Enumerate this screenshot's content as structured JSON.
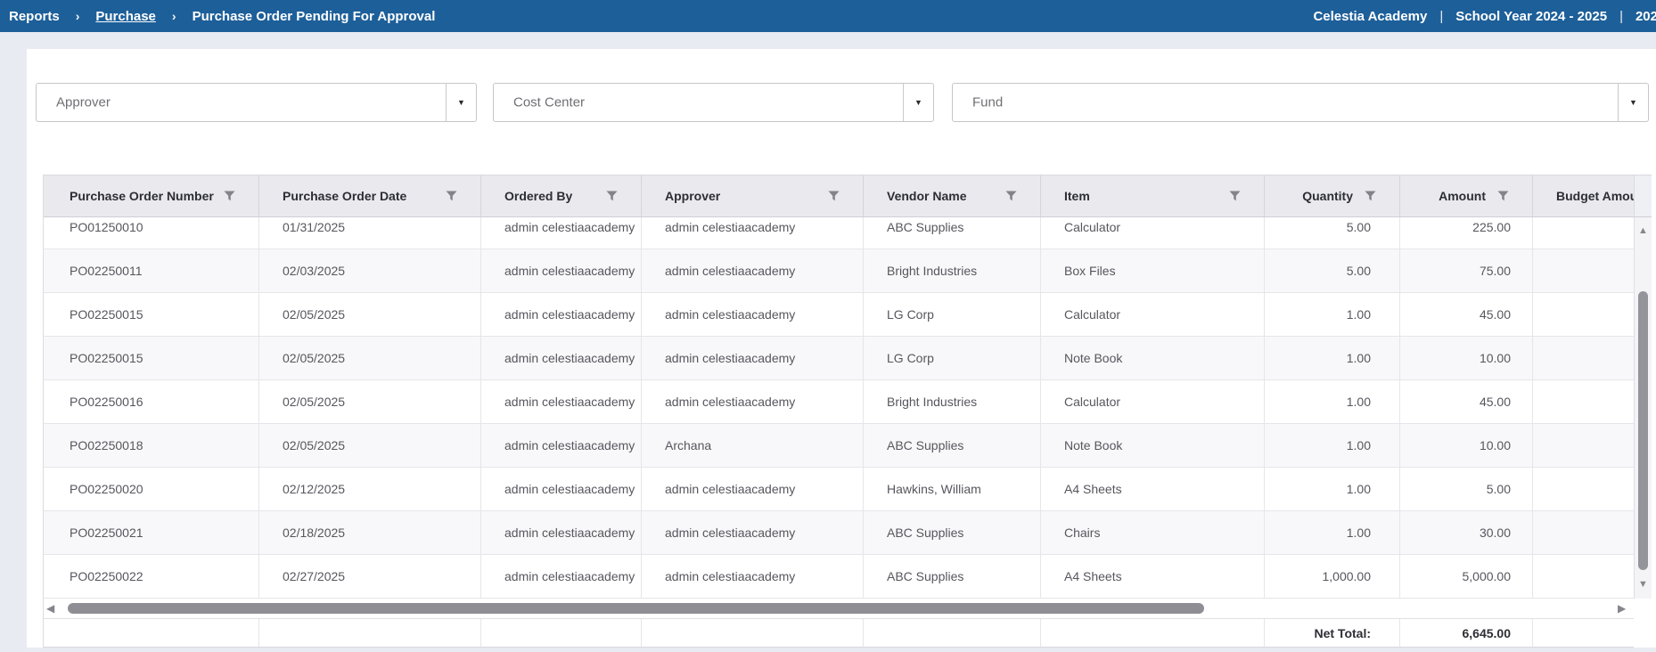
{
  "colors": {
    "topbar_bg": "#1d5f99",
    "page_bg": "#e9ebf2",
    "table_header_bg": "#e9e9ee"
  },
  "topbar": {
    "breadcrumb": [
      {
        "label": "Reports",
        "link": false
      },
      {
        "label": "Purchase",
        "link": true
      },
      {
        "label": "Purchase Order Pending For Approval",
        "link": false
      }
    ],
    "separator": "›",
    "pipe": "|",
    "info_segments": [
      "Celestia Academy",
      "School Year 2024 - 2025",
      "202"
    ]
  },
  "filters": [
    {
      "placeholder": "Approver"
    },
    {
      "placeholder": "Cost Center"
    },
    {
      "placeholder": "Fund"
    }
  ],
  "table": {
    "columns": [
      {
        "label": "Purchase Order Number",
        "filter": true,
        "align": "left"
      },
      {
        "label": "Purchase Order Date",
        "filter": true,
        "align": "left"
      },
      {
        "label": "Ordered By",
        "filter": true,
        "align": "left"
      },
      {
        "label": "Approver",
        "filter": true,
        "align": "left"
      },
      {
        "label": "Vendor Name",
        "filter": true,
        "align": "left"
      },
      {
        "label": "Item",
        "filter": true,
        "align": "left"
      },
      {
        "label": "Quantity",
        "filter": true,
        "align": "right"
      },
      {
        "label": "Amount",
        "filter": true,
        "align": "right"
      },
      {
        "label": "Budget Amount",
        "filter": false,
        "align": "left"
      }
    ],
    "rows": [
      [
        "PO01250010",
        "01/31/2025",
        "admin celestiaacademy",
        "admin celestiaacademy",
        "ABC Supplies",
        "Calculator",
        "5.00",
        "225.00",
        ""
      ],
      [
        "PO02250011",
        "02/03/2025",
        "admin celestiaacademy",
        "admin celestiaacademy",
        "Bright Industries",
        "Box Files",
        "5.00",
        "75.00",
        ""
      ],
      [
        "PO02250015",
        "02/05/2025",
        "admin celestiaacademy",
        "admin celestiaacademy",
        "LG Corp",
        "Calculator",
        "1.00",
        "45.00",
        ""
      ],
      [
        "PO02250015",
        "02/05/2025",
        "admin celestiaacademy",
        "admin celestiaacademy",
        "LG Corp",
        "Note Book",
        "1.00",
        "10.00",
        ""
      ],
      [
        "PO02250016",
        "02/05/2025",
        "admin celestiaacademy",
        "admin celestiaacademy",
        "Bright Industries",
        "Calculator",
        "1.00",
        "45.00",
        ""
      ],
      [
        "PO02250018",
        "02/05/2025",
        "admin celestiaacademy",
        "Archana",
        "ABC Supplies",
        "Note Book",
        "1.00",
        "10.00",
        ""
      ],
      [
        "PO02250020",
        "02/12/2025",
        "admin celestiaacademy",
        "admin celestiaacademy",
        "Hawkins, William",
        "A4 Sheets",
        "1.00",
        "5.00",
        ""
      ],
      [
        "PO02250021",
        "02/18/2025",
        "admin celestiaacademy",
        "admin celestiaacademy",
        "ABC Supplies",
        "Chairs",
        "1.00",
        "30.00",
        ""
      ],
      [
        "PO02250022",
        "02/27/2025",
        "admin celestiaacademy",
        "admin celestiaacademy",
        "ABC Supplies",
        "A4 Sheets",
        "1,000.00",
        "5,000.00",
        ""
      ]
    ],
    "footer_cells": [
      "",
      "",
      "",
      "",
      "",
      "",
      "Net Total:",
      "6,645.00",
      ""
    ]
  }
}
